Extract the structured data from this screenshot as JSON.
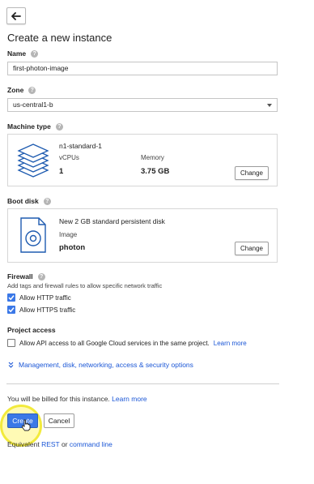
{
  "header": {
    "back_icon": "arrow-back-icon"
  },
  "title": "Create a new instance",
  "name": {
    "label": "Name",
    "value": "first-photon-image"
  },
  "zone": {
    "label": "Zone",
    "value": "us-central1-b"
  },
  "machine_type": {
    "label": "Machine type",
    "name": "n1-standard-1",
    "vcpus_label": "vCPUs",
    "vcpus_value": "1",
    "memory_label": "Memory",
    "memory_value": "3.75 GB",
    "change_label": "Change",
    "icon": "layers-stack-icon"
  },
  "boot_disk": {
    "label": "Boot disk",
    "description": "New 2 GB standard persistent disk",
    "image_label": "Image",
    "image_value": "photon",
    "change_label": "Change",
    "icon": "disk-image-icon"
  },
  "firewall": {
    "label": "Firewall",
    "hint": "Add tags and firewall rules to allow specific network traffic",
    "options": [
      {
        "label": "Allow HTTP traffic",
        "checked": true
      },
      {
        "label": "Allow HTTPS traffic",
        "checked": true
      }
    ]
  },
  "project_access": {
    "label": "Project access",
    "option_label": "Allow API access to all Google Cloud services in the same project.",
    "learn_more": "Learn more",
    "checked": false
  },
  "expander": {
    "label": "Management, disk, networking, access & security options"
  },
  "billing": {
    "text": "You will be billed for this instance.",
    "learn_more": "Learn more"
  },
  "actions": {
    "create_label": "Create",
    "cancel_label": "Cancel"
  },
  "equivalent": {
    "prefix": "Equivalent",
    "rest_link": "REST",
    "or_text": "or",
    "cli_link": "command line"
  },
  "colors": {
    "accent": "#3b78e7",
    "link": "#1a56d6",
    "highlight": "#f2ea3c"
  }
}
